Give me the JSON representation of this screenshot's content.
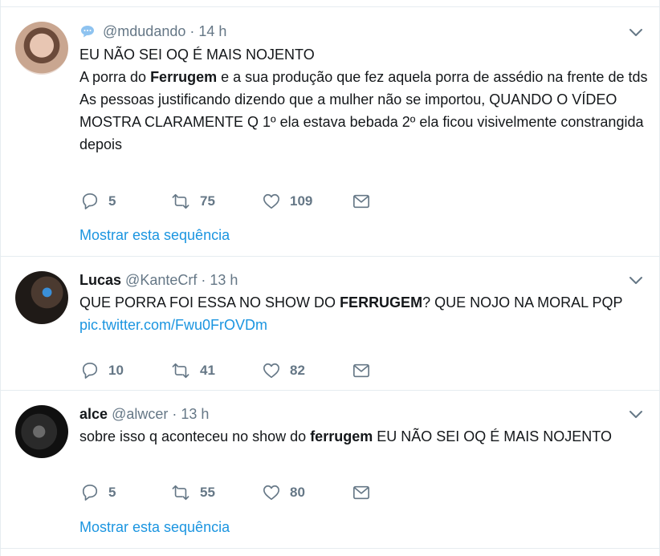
{
  "tweets": [
    {
      "name": "",
      "handle": "@mdudando",
      "time": "14 h",
      "lines": [
        {
          "pre": "EU NÃO SEI OQ É MAIS NOJENTO"
        },
        {
          "pre": "A porra do ",
          "bold": "Ferrugem",
          "post": " e a sua produção que fez aquela porra de assédio na frente de tds"
        },
        {
          "pre": "As pessoas justificando dizendo que a mulher não se importou, QUANDO O VÍDEO MOSTRA CLARAMENTE Q 1º ela estava bebada 2º ela ficou visivelmente constrangida depois"
        }
      ],
      "replies": "5",
      "retweets": "75",
      "likes": "109",
      "show_thread": "Mostrar esta sequência"
    },
    {
      "name": "Lucas",
      "handle": "@KanteCrf",
      "time": "13 h",
      "text_pre": "QUE PORRA FOI ESSA NO SHOW DO ",
      "text_bold": "FERRUGEM",
      "text_post": "? QUE NOJO NA MORAL PQP ",
      "link": "pic.twitter.com/Fwu0FrOVDm",
      "replies": "10",
      "retweets": "41",
      "likes": "82"
    },
    {
      "name": "alce",
      "handle": "@alwcer",
      "time": "13 h",
      "text_pre": "sobre isso q aconteceu no show do ",
      "text_bold": "ferrugem",
      "text_post": " EU NÃO SEI OQ É MAIS NOJENTO",
      "replies": "5",
      "retweets": "55",
      "likes": "80",
      "show_thread": "Mostrar esta sequência"
    }
  ],
  "separator": "·",
  "icons": {
    "conversation": "conversation-icon",
    "reply": "reply-icon",
    "retweet": "retweet-icon",
    "like": "heart-icon",
    "dm": "envelope-icon",
    "menu": "chevron-down-icon"
  },
  "colors": {
    "link": "#1b95e0",
    "secondary": "#657786",
    "text": "#14171a",
    "border": "#e6ecf0"
  }
}
